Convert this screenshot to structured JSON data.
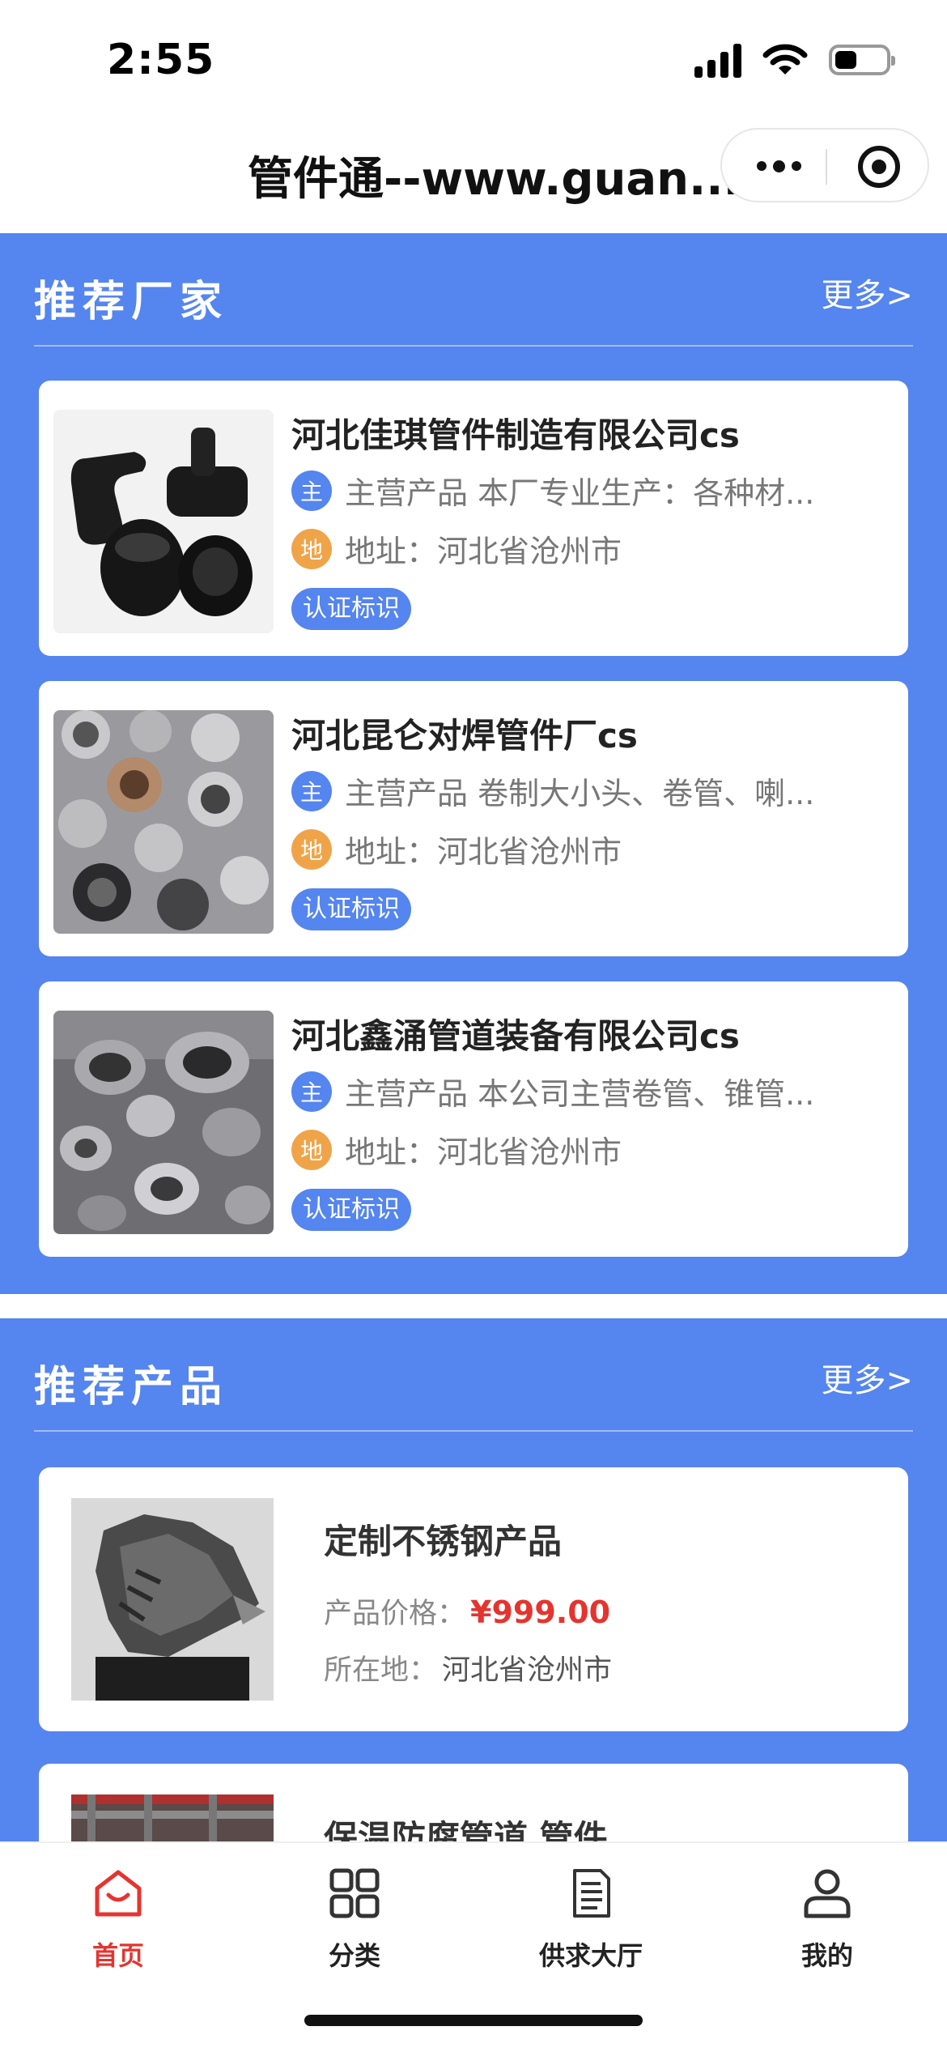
{
  "status_bar": {
    "time": "2:55"
  },
  "nav": {
    "title": "管件通--www.guan..."
  },
  "vendors_section": {
    "title": "推荐厂家",
    "more": "更多>",
    "items": [
      {
        "name": "河北佳琪管件制造有限公司cs",
        "main_tag": "主",
        "main_products": "主营产品  本厂专业生产：各种材...",
        "addr_tag": "地",
        "address": "地址：河北省沧州市",
        "badge": "认证标识",
        "image_icon": "black-pipe-fittings-photo"
      },
      {
        "name": "河北昆仑对焊管件厂cs",
        "main_tag": "主",
        "main_products": "主营产品  卷制大小头、卷管、喇...",
        "addr_tag": "地",
        "address": "地址：河北省沧州市",
        "badge": "认证标识",
        "image_icon": "metal-fittings-photo"
      },
      {
        "name": "河北鑫涌管道装备有限公司cs",
        "main_tag": "主",
        "main_products": "主营产品  本公司主营卷管、锥管...",
        "addr_tag": "地",
        "address": "地址：河北省沧州市",
        "badge": "认证标识",
        "image_icon": "steel-fittings-photo"
      }
    ]
  },
  "products_section": {
    "title": "推荐产品",
    "more": "更多>",
    "items": [
      {
        "name": "定制不锈钢产品",
        "price_label": "产品价格：",
        "price": "¥999.00",
        "location_label": "所在地：",
        "location": "河北省沧州市",
        "image_icon": "steel-sculpture-photo"
      },
      {
        "name": "保温防腐管道 管件",
        "image_icon": "insulated-pipe-photo"
      }
    ]
  },
  "tab_bar": {
    "tabs": [
      {
        "label": "首页",
        "icon": "home-icon",
        "active": true
      },
      {
        "label": "分类",
        "icon": "grid-icon",
        "active": false
      },
      {
        "label": "供求大厅",
        "icon": "document-icon",
        "active": false
      },
      {
        "label": "我的",
        "icon": "user-icon",
        "active": false
      }
    ]
  },
  "colors": {
    "accent": "#5585ee",
    "active_tab": "#e5342f",
    "address_tag": "#f0a44a",
    "price": "#e5342f"
  }
}
